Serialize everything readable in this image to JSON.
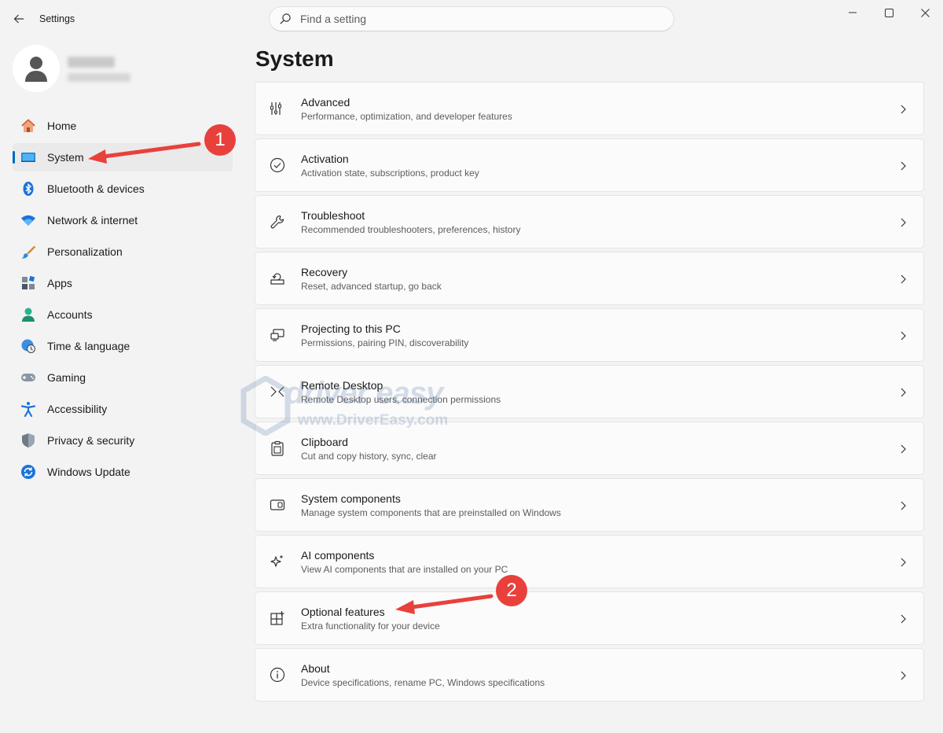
{
  "app": {
    "title": "Settings"
  },
  "search": {
    "placeholder": "Find a setting"
  },
  "page": {
    "title": "System"
  },
  "sidebar": {
    "items": [
      {
        "label": "Home",
        "icon": "home-icon",
        "active": false
      },
      {
        "label": "System",
        "icon": "system-icon",
        "active": true
      },
      {
        "label": "Bluetooth & devices",
        "icon": "bluetooth-icon",
        "active": false
      },
      {
        "label": "Network & internet",
        "icon": "wifi-icon",
        "active": false
      },
      {
        "label": "Personalization",
        "icon": "brush-icon",
        "active": false
      },
      {
        "label": "Apps",
        "icon": "apps-icon",
        "active": false
      },
      {
        "label": "Accounts",
        "icon": "accounts-icon",
        "active": false
      },
      {
        "label": "Time & language",
        "icon": "globe-clock-icon",
        "active": false
      },
      {
        "label": "Gaming",
        "icon": "gamepad-icon",
        "active": false
      },
      {
        "label": "Accessibility",
        "icon": "accessibility-icon",
        "active": false
      },
      {
        "label": "Privacy & security",
        "icon": "shield-icon",
        "active": false
      },
      {
        "label": "Windows Update",
        "icon": "update-icon",
        "active": false
      }
    ]
  },
  "cards": [
    {
      "title": "Advanced",
      "subtitle": "Performance, optimization, and developer features",
      "icon": "advanced-icon"
    },
    {
      "title": "Activation",
      "subtitle": "Activation state, subscriptions, product key",
      "icon": "check-circle-icon"
    },
    {
      "title": "Troubleshoot",
      "subtitle": "Recommended troubleshooters, preferences, history",
      "icon": "wrench-icon"
    },
    {
      "title": "Recovery",
      "subtitle": "Reset, advanced startup, go back",
      "icon": "recovery-icon"
    },
    {
      "title": "Projecting to this PC",
      "subtitle": "Permissions, pairing PIN, discoverability",
      "icon": "projecting-icon"
    },
    {
      "title": "Remote Desktop",
      "subtitle": "Remote Desktop users, connection permissions",
      "icon": "remote-desktop-icon"
    },
    {
      "title": "Clipboard",
      "subtitle": "Cut and copy history, sync, clear",
      "icon": "clipboard-icon"
    },
    {
      "title": "System components",
      "subtitle": "Manage system components that are preinstalled on Windows",
      "icon": "components-icon"
    },
    {
      "title": "AI components",
      "subtitle": "View AI components that are installed on your PC",
      "icon": "sparkle-icon"
    },
    {
      "title": "Optional features",
      "subtitle": "Extra functionality for your device",
      "icon": "optional-features-icon"
    },
    {
      "title": "About",
      "subtitle": "Device specifications, rename PC, Windows specifications",
      "icon": "info-icon"
    }
  ],
  "annotations": {
    "step1": "1",
    "step2": "2",
    "color": "#e8413c"
  },
  "watermark": {
    "brand": "driver easy",
    "url": "www.DriverEasy.com"
  },
  "colors": {
    "accent": "#0067c0",
    "background": "#f3f3f3",
    "card": "#fbfbfb"
  }
}
